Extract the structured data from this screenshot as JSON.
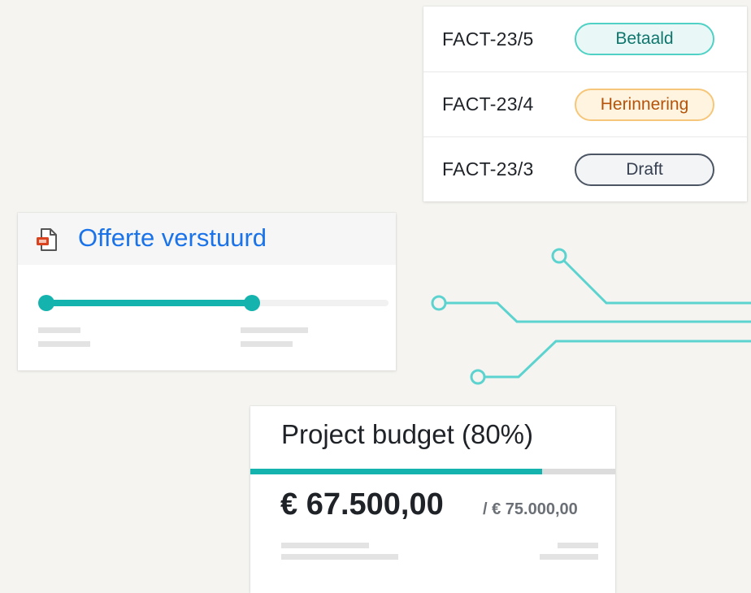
{
  "invoices": [
    {
      "id": "FACT-23/5",
      "status": "Betaald",
      "status_color": "#0f766e",
      "badge_bg": "#e9f8f7",
      "badge_border": "#4fd1c5"
    },
    {
      "id": "FACT-23/4",
      "status": "Herinnering",
      "status_color": "#b45309",
      "badge_bg": "#fff4e0",
      "badge_border": "#f6c77a"
    },
    {
      "id": "FACT-23/3",
      "status": "Draft",
      "status_color": "#374151",
      "badge_bg": "#f3f4f6",
      "badge_border": "#4b5563"
    }
  ],
  "offerte": {
    "icon": "document-icon",
    "title": "Offerte verstuurd",
    "progress": 0.6
  },
  "budget": {
    "title": "Project budget (80%)",
    "progress": 0.8,
    "amount": "€ 67.500,00",
    "total": "/ € 75.000,00"
  },
  "colors": {
    "accent": "#14b3ae",
    "link": "#1a73e8",
    "circuit": "#5dd3cf"
  }
}
